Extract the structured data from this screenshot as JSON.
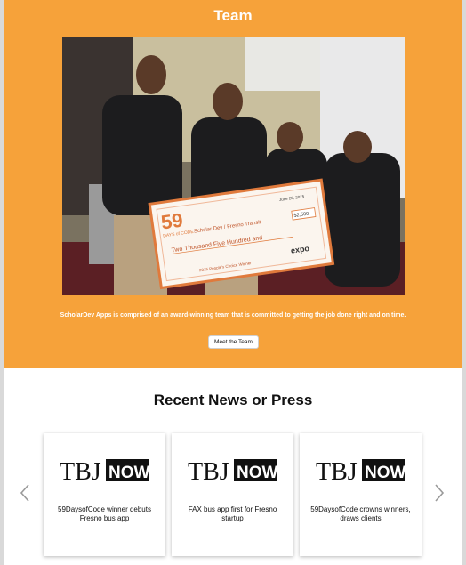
{
  "team": {
    "title": "Team",
    "description": "ScholarDev Apps is comprised of an award-winning team that is committed to getting the job done right and on time.",
    "button_label": "Meet the Team",
    "check": {
      "brand_number": "59",
      "brand_text": "DAYS of CODE",
      "date": "June 28, 2015",
      "payee": "Scholar Dev / Fresno Transit",
      "amount": "$2,500",
      "amount_words": "Two Thousand Five Hundred and",
      "memo": "2015 People's Choice Winner",
      "sponsor": "expo"
    }
  },
  "news": {
    "title": "Recent News or Press",
    "cards": [
      {
        "logo_text": "TBJ",
        "logo_badge": "NOW",
        "headline": "59DaysofCode winner debuts Fresno bus app"
      },
      {
        "logo_text": "TBJ",
        "logo_badge": "NOW",
        "headline": "FAX bus app first for Fresno startup"
      },
      {
        "logo_text": "TBJ",
        "logo_badge": "NOW",
        "headline": "59DaysofCode crowns winners, draws clients"
      }
    ]
  },
  "colors": {
    "accent": "#f6a23a",
    "background": "#ffffff"
  },
  "icons": {
    "prev": "chevron-left-icon",
    "next": "chevron-right-icon"
  }
}
